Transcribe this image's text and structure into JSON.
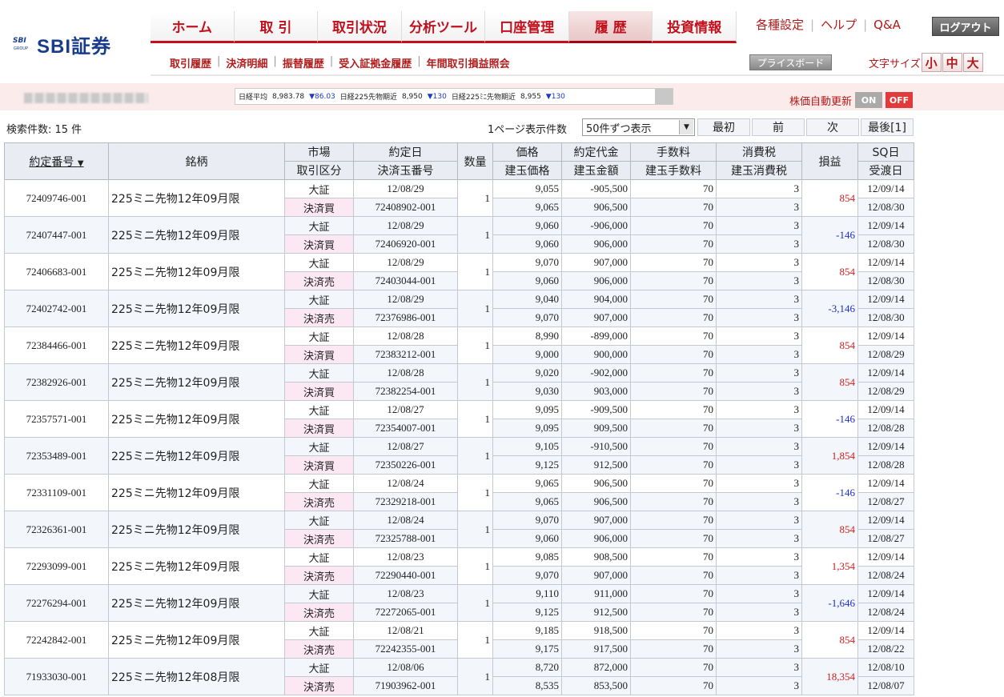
{
  "header": {
    "logo_text": "SBI証券",
    "logo_small": "SBI",
    "logo_group": "GROUP",
    "nav": [
      "ホーム",
      "取 引",
      "取引状況",
      "分析ツール",
      "口座管理",
      "履 歴",
      "投資情報"
    ],
    "active_index": 5,
    "settings": "各種設定",
    "help": "ヘルプ",
    "qa": "Q&A",
    "logout": "ログアウト",
    "subnav": [
      "取引履歴",
      "決済明細",
      "振替履歴",
      "受入証拠金履歴",
      "年間取引損益照会"
    ],
    "priceboard": "プライスボード",
    "fontsize_label": "文字サイズ",
    "fontsize_options": [
      "小",
      "中",
      "大"
    ]
  },
  "ticker": {
    "items": [
      {
        "label": "日経平均",
        "value": "8,983.78",
        "change": "▼86.03"
      },
      {
        "label": "日経225先物期近",
        "value": "8,950",
        "change": "▼130"
      },
      {
        "label": "日経225ﾐﾆ先物期近",
        "value": "8,955",
        "change": "▼130"
      }
    ],
    "auto_update_label": "株価自動更新",
    "on_label": "ON",
    "off_label": "OFF"
  },
  "results": {
    "count": "検索件数: 15 件",
    "perpage_label": "1ページ表示件数",
    "perpage_value": "50件ずつ表示",
    "first": "最初",
    "prev": "前",
    "next": "次",
    "last": "最後[1]"
  },
  "table": {
    "headers": {
      "order": "約定番号",
      "sort_arrow": "▼",
      "name": "銘柄",
      "market": "市場",
      "trade_type": "取引区分",
      "date": "約定日",
      "pos_no": "決済玉番号",
      "qty": "数量",
      "price": "価格",
      "open_price": "建玉価格",
      "amount": "約定代金",
      "open_amount": "建玉金額",
      "fee": "手数料",
      "open_fee": "建玉手数料",
      "tax": "消費税",
      "open_tax": "建玉消費税",
      "pl": "損益",
      "sq": "SQ日",
      "settle": "受渡日"
    },
    "rows": [
      {
        "order": "72409746-001",
        "name": "225ミニ先物12年09月限",
        "market": "大証",
        "type": "決済買",
        "date": "12/08/29",
        "pos": "72408902-001",
        "qty": "1",
        "price": "9,055",
        "oprice": "9,065",
        "amount": "-905,500",
        "oamount": "906,500",
        "fee": "70",
        "ofee": "70",
        "tax": "3",
        "otax": "3",
        "pl": "854",
        "sign": "pos",
        "sq": "12/09/14",
        "settle": "12/08/30"
      },
      {
        "order": "72407447-001",
        "name": "225ミニ先物12年09月限",
        "market": "大証",
        "type": "決済買",
        "date": "12/08/29",
        "pos": "72406920-001",
        "qty": "1",
        "price": "9,060",
        "oprice": "9,060",
        "amount": "-906,000",
        "oamount": "906,000",
        "fee": "70",
        "ofee": "70",
        "tax": "3",
        "otax": "3",
        "pl": "-146",
        "sign": "neg",
        "sq": "12/09/14",
        "settle": "12/08/30"
      },
      {
        "order": "72406683-001",
        "name": "225ミニ先物12年09月限",
        "market": "大証",
        "type": "決済売",
        "date": "12/08/29",
        "pos": "72403044-001",
        "qty": "1",
        "price": "9,070",
        "oprice": "9,060",
        "amount": "907,000",
        "oamount": "906,000",
        "fee": "70",
        "ofee": "70",
        "tax": "3",
        "otax": "3",
        "pl": "854",
        "sign": "pos",
        "sq": "12/09/14",
        "settle": "12/08/30"
      },
      {
        "order": "72402742-001",
        "name": "225ミニ先物12年09月限",
        "market": "大証",
        "type": "決済売",
        "date": "12/08/29",
        "pos": "72376986-001",
        "qty": "1",
        "price": "9,040",
        "oprice": "9,070",
        "amount": "904,000",
        "oamount": "907,000",
        "fee": "70",
        "ofee": "70",
        "tax": "3",
        "otax": "3",
        "pl": "-3,146",
        "sign": "neg",
        "sq": "12/09/14",
        "settle": "12/08/30"
      },
      {
        "order": "72384466-001",
        "name": "225ミニ先物12年09月限",
        "market": "大証",
        "type": "決済買",
        "date": "12/08/28",
        "pos": "72383212-001",
        "qty": "1",
        "price": "8,990",
        "oprice": "9,000",
        "amount": "-899,000",
        "oamount": "900,000",
        "fee": "70",
        "ofee": "70",
        "tax": "3",
        "otax": "3",
        "pl": "854",
        "sign": "pos",
        "sq": "12/09/14",
        "settle": "12/08/29"
      },
      {
        "order": "72382926-001",
        "name": "225ミニ先物12年09月限",
        "market": "大証",
        "type": "決済買",
        "date": "12/08/28",
        "pos": "72382254-001",
        "qty": "1",
        "price": "9,020",
        "oprice": "9,030",
        "amount": "-902,000",
        "oamount": "903,000",
        "fee": "70",
        "ofee": "70",
        "tax": "3",
        "otax": "3",
        "pl": "854",
        "sign": "pos",
        "sq": "12/09/14",
        "settle": "12/08/29"
      },
      {
        "order": "72357571-001",
        "name": "225ミニ先物12年09月限",
        "market": "大証",
        "type": "決済買",
        "date": "12/08/27",
        "pos": "72354007-001",
        "qty": "1",
        "price": "9,095",
        "oprice": "9,095",
        "amount": "-909,500",
        "oamount": "909,500",
        "fee": "70",
        "ofee": "70",
        "tax": "3",
        "otax": "3",
        "pl": "-146",
        "sign": "neg",
        "sq": "12/09/14",
        "settle": "12/08/28"
      },
      {
        "order": "72353489-001",
        "name": "225ミニ先物12年09月限",
        "market": "大証",
        "type": "決済買",
        "date": "12/08/27",
        "pos": "72350226-001",
        "qty": "1",
        "price": "9,105",
        "oprice": "9,125",
        "amount": "-910,500",
        "oamount": "912,500",
        "fee": "70",
        "ofee": "70",
        "tax": "3",
        "otax": "3",
        "pl": "1,854",
        "sign": "pos",
        "sq": "12/09/14",
        "settle": "12/08/28"
      },
      {
        "order": "72331109-001",
        "name": "225ミニ先物12年09月限",
        "market": "大証",
        "type": "決済売",
        "date": "12/08/24",
        "pos": "72329218-001",
        "qty": "1",
        "price": "9,065",
        "oprice": "9,065",
        "amount": "906,500",
        "oamount": "906,500",
        "fee": "70",
        "ofee": "70",
        "tax": "3",
        "otax": "3",
        "pl": "-146",
        "sign": "neg",
        "sq": "12/09/14",
        "settle": "12/08/27"
      },
      {
        "order": "72326361-001",
        "name": "225ミニ先物12年09月限",
        "market": "大証",
        "type": "決済売",
        "date": "12/08/24",
        "pos": "72325788-001",
        "qty": "1",
        "price": "9,070",
        "oprice": "9,060",
        "amount": "907,000",
        "oamount": "906,000",
        "fee": "70",
        "ofee": "70",
        "tax": "3",
        "otax": "3",
        "pl": "854",
        "sign": "pos",
        "sq": "12/09/14",
        "settle": "12/08/27"
      },
      {
        "order": "72293099-001",
        "name": "225ミニ先物12年09月限",
        "market": "大証",
        "type": "決済売",
        "date": "12/08/23",
        "pos": "72290440-001",
        "qty": "1",
        "price": "9,085",
        "oprice": "9,070",
        "amount": "908,500",
        "oamount": "907,000",
        "fee": "70",
        "ofee": "70",
        "tax": "3",
        "otax": "3",
        "pl": "1,354",
        "sign": "pos",
        "sq": "12/09/14",
        "settle": "12/08/24"
      },
      {
        "order": "72276294-001",
        "name": "225ミニ先物12年09月限",
        "market": "大証",
        "type": "決済売",
        "date": "12/08/23",
        "pos": "72272065-001",
        "qty": "1",
        "price": "9,110",
        "oprice": "9,125",
        "amount": "911,000",
        "oamount": "912,500",
        "fee": "70",
        "ofee": "70",
        "tax": "3",
        "otax": "3",
        "pl": "-1,646",
        "sign": "neg",
        "sq": "12/09/14",
        "settle": "12/08/24"
      },
      {
        "order": "72242842-001",
        "name": "225ミニ先物12年09月限",
        "market": "大証",
        "type": "決済売",
        "date": "12/08/21",
        "pos": "72242355-001",
        "qty": "1",
        "price": "9,185",
        "oprice": "9,175",
        "amount": "918,500",
        "oamount": "917,500",
        "fee": "70",
        "ofee": "70",
        "tax": "3",
        "otax": "3",
        "pl": "854",
        "sign": "pos",
        "sq": "12/09/14",
        "settle": "12/08/22"
      },
      {
        "order": "71933030-001",
        "name": "225ミニ先物12年08月限",
        "market": "大証",
        "type": "決済売",
        "date": "12/08/06",
        "pos": "71903962-001",
        "qty": "1",
        "price": "8,720",
        "oprice": "8,535",
        "amount": "872,000",
        "oamount": "853,500",
        "fee": "70",
        "ofee": "70",
        "tax": "3",
        "otax": "3",
        "pl": "18,354",
        "sign": "pos",
        "sq": "12/08/10",
        "settle": "12/08/07"
      }
    ]
  },
  "colors": {
    "brand_red": "#c4101c",
    "profit": "#d81c1c",
    "loss": "#1d2fc9",
    "header_bg": "#e9edf3"
  }
}
